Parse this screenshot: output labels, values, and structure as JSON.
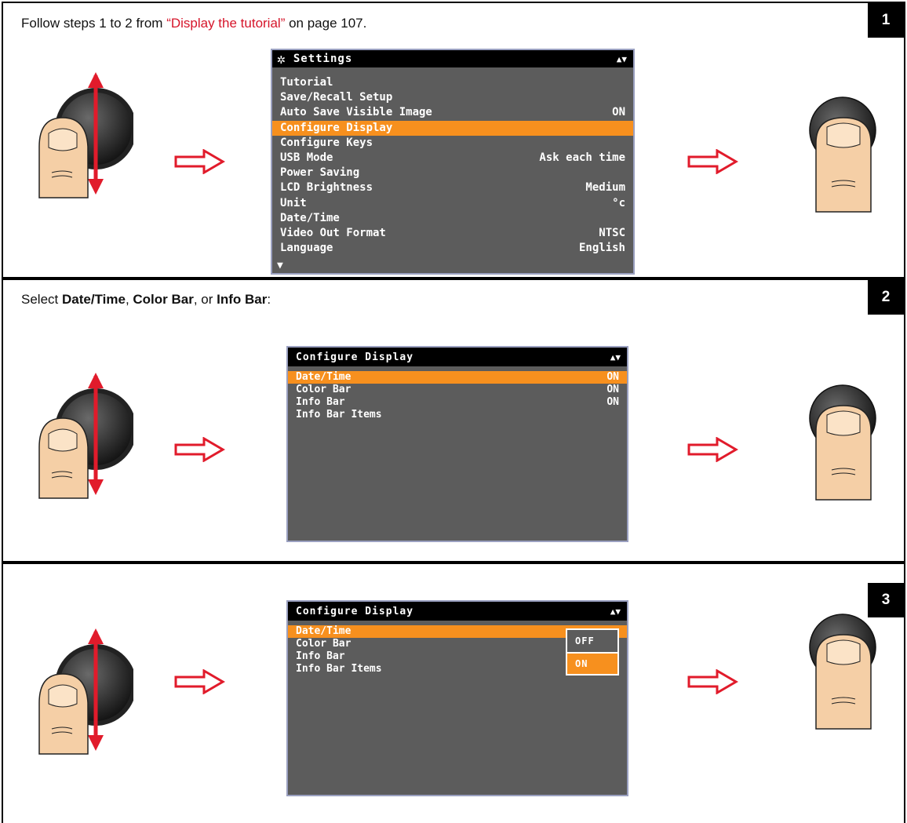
{
  "steps": [
    {
      "badge": "1",
      "instruction": {
        "prefix": "Follow steps 1 to 2 from ",
        "link": "“Display the tutorial”",
        "suffix": " on page 107."
      },
      "screen": {
        "title": "Settings",
        "icon": "gear-icon",
        "items": [
          {
            "label": "Tutorial",
            "value": ""
          },
          {
            "label": "Save/Recall Setup",
            "value": ""
          },
          {
            "label": "Auto Save Visible Image",
            "value": "ON"
          },
          {
            "label": "Configure Display",
            "value": "",
            "selected": true
          },
          {
            "label": "Configure Keys",
            "value": ""
          },
          {
            "label": "USB Mode",
            "value": "Ask each time"
          },
          {
            "label": "Power Saving",
            "value": ""
          },
          {
            "label": "LCD Brightness",
            "value": "Medium"
          },
          {
            "label": "Unit",
            "value": "°c"
          },
          {
            "label": "Date/Time",
            "value": ""
          },
          {
            "label": "Video Out Format",
            "value": "NTSC"
          },
          {
            "label": "Language",
            "value": "English"
          }
        ]
      }
    },
    {
      "badge": "2",
      "instruction": {
        "prefix": "Select ",
        "opt1": "Date/Time",
        "sep1": ", ",
        "opt2": "Color Bar",
        "sep2": ", or ",
        "opt3": "Info Bar",
        "suffix": ":"
      },
      "screen": {
        "title": "Configure Display",
        "items": [
          {
            "label": "Date/Time",
            "value": "ON",
            "selected": true
          },
          {
            "label": "Color Bar",
            "value": "ON"
          },
          {
            "label": "Info Bar",
            "value": "ON"
          },
          {
            "label": "Info Bar Items",
            "value": ""
          }
        ]
      }
    },
    {
      "badge": "3",
      "screen": {
        "title": "Configure Display",
        "items": [
          {
            "label": "Date/Time",
            "value": "",
            "selected": true
          },
          {
            "label": "Color Bar",
            "value": ""
          },
          {
            "label": "Info Bar",
            "value": ""
          },
          {
            "label": "Info Bar Items",
            "value": ""
          }
        ],
        "popup": {
          "options": [
            {
              "label": "OFF"
            },
            {
              "label": "ON",
              "selected": true
            }
          ]
        }
      }
    }
  ],
  "colors": {
    "accent_red": "#d6152a",
    "highlight_orange": "#f7901e",
    "lcd_bg": "#5c5c5c",
    "skin": "#f5cfa6"
  }
}
